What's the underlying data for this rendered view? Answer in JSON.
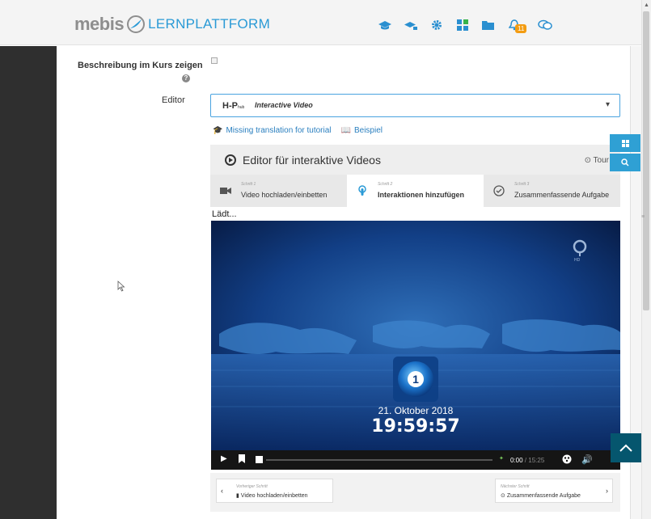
{
  "header": {
    "logo_text": "mebis",
    "logo_suffix": "LERNPLATTFORM",
    "notification_count": "11",
    "icons": [
      "graduation-cap-icon",
      "course-icon",
      "gear-icon",
      "dashboard-tiles-icon",
      "folder-icon",
      "bell-icon",
      "chat-icon"
    ]
  },
  "form": {
    "show_description_label": "Beschreibung im Kurs zeigen",
    "editor_label": "Editor",
    "editor_select_value": "Interactive Video",
    "h5p_logo": "H-P",
    "h5p_logo_small": "hub",
    "links": {
      "tutorial": "Missing translation for tutorial",
      "example": "Beispiel"
    }
  },
  "editor": {
    "title": "Editor für interaktive Videos",
    "tour_label": "Tour",
    "loading_text": "Lädt...",
    "steps": [
      {
        "number": "Schritt 1",
        "label": "Video hochladen/einbetten",
        "active": false
      },
      {
        "number": "Schritt 2",
        "label": "Interaktionen hinzufügen",
        "active": true
      },
      {
        "number": "Schritt 3",
        "label": "Zusammenfassende Aufgabe",
        "active": false
      }
    ],
    "video": {
      "date": "21. Oktober 2018",
      "time": "19:59:57",
      "current_time": "0:00",
      "duration": "15:25",
      "channel_badge": "HD"
    },
    "nav": {
      "prev_label": "Vorheriger Schritt",
      "prev_step": "Video hochladen/einbetten",
      "next_label": "Nächster Schritt",
      "next_step": "Zusammenfassende Aufgabe"
    }
  },
  "colors": {
    "accent": "#2a9ad6",
    "sidebar": "#2f2f2f",
    "back_to_top": "#05566e",
    "badge": "#f39c12"
  }
}
